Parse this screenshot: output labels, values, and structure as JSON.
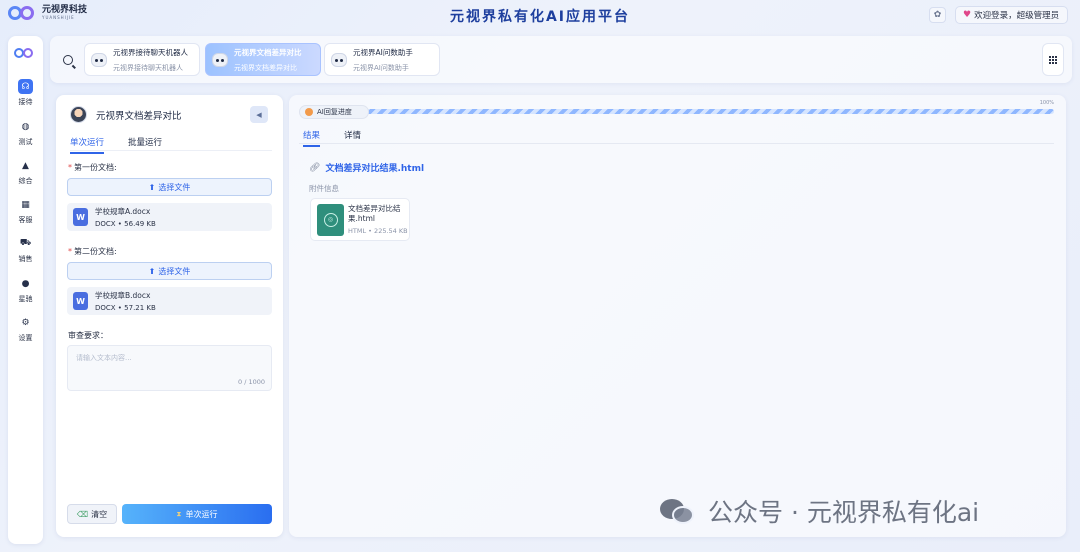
{
  "header": {
    "logo_name": "元视界科技",
    "logo_sub": "YUANSHIJIE",
    "title": "元视界私有化AI应用平台",
    "user_text": "欢迎登录，超级管理员"
  },
  "nav": {
    "items": [
      {
        "label": "接待",
        "icon": "headset-icon"
      },
      {
        "label": "测试",
        "icon": "globe-icon"
      },
      {
        "label": "综合",
        "icon": "bell-icon"
      },
      {
        "label": "客服",
        "icon": "grid-icon"
      },
      {
        "label": "销售",
        "icon": "cart-icon"
      },
      {
        "label": "星驰",
        "icon": "planet-icon"
      },
      {
        "label": "设置",
        "icon": "gear-icon"
      }
    ]
  },
  "tabs": [
    {
      "title": "元视界接待聊天机器人",
      "subtitle": "元视界接待聊天机器人"
    },
    {
      "title": "元视界文档差异对比",
      "subtitle": "元视界文档差异对比"
    },
    {
      "title": "元视界AI问数助手",
      "subtitle": "元视界AI问数助手"
    }
  ],
  "left_panel": {
    "title": "元视界文档差异对比",
    "tabs": [
      "单次运行",
      "批量运行"
    ],
    "doc1": {
      "label": "第一份文档:",
      "upload_label": "选择文件",
      "file_name": "学校规章A.docx",
      "file_meta": "DOCX • 56.49 KB"
    },
    "doc2": {
      "label": "第二份文档:",
      "upload_label": "选择文件",
      "file_name": "学校规章B.docx",
      "file_meta": "DOCX • 57.21 KB"
    },
    "review": {
      "label": "审查要求：",
      "placeholder": "请输入文本内容...",
      "counter": "0 / 1000"
    },
    "clear_label": "清空",
    "run_label": "单次运行"
  },
  "right_panel": {
    "progress_label": "AI回复进度",
    "progress_pct": "100%",
    "progress_value": 1.0,
    "tabs": [
      "结果",
      "详情"
    ],
    "result_link": "文档差异对比结果.html",
    "attach_label": "附件信息",
    "attachment": {
      "name": "文档差异对比结果.html",
      "meta": "HTML • 225.54 KB"
    }
  },
  "watermark": {
    "text": "公众号 · 元视界私有化ai"
  },
  "colors": {
    "accent": "#2f64e8",
    "brand_title": "#1e3f9e",
    "run_gradient_start": "#56b3fb",
    "run_gradient_end": "#2a6ef0"
  }
}
